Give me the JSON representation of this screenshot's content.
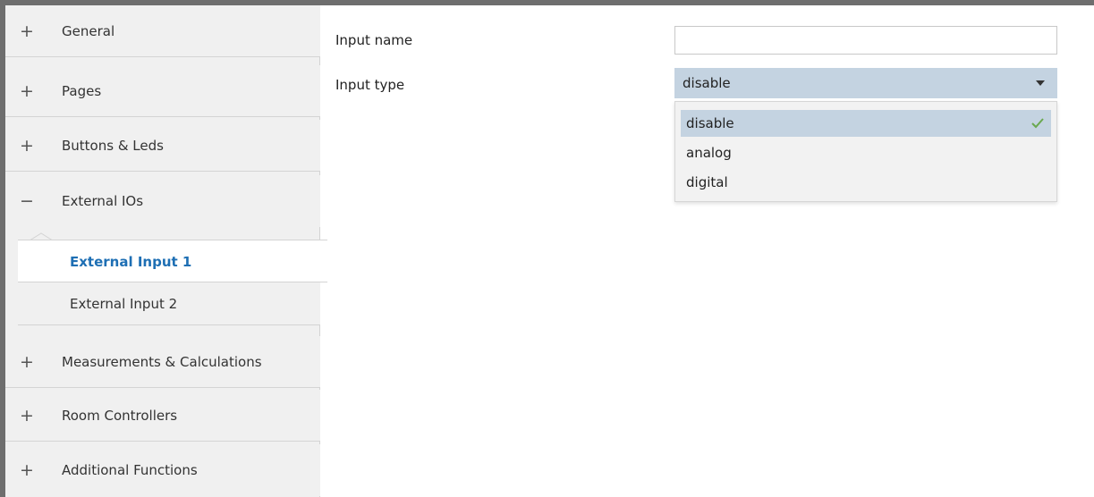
{
  "sidebar": {
    "items": [
      {
        "symbol": "+",
        "label": "General"
      },
      {
        "symbol": "+",
        "label": "Pages"
      },
      {
        "symbol": "+",
        "label": "Buttons & Leds"
      },
      {
        "symbol": "−",
        "label": "External IOs"
      },
      {
        "symbol": "+",
        "label": "Measurements & Calculations"
      },
      {
        "symbol": "+",
        "label": "Room Controllers"
      },
      {
        "symbol": "+",
        "label": "Additional Functions"
      }
    ],
    "subitems": [
      {
        "label": "External Input 1"
      },
      {
        "label": "External Input 2"
      }
    ]
  },
  "form": {
    "input_name_label": "Input name",
    "input_name_value": "",
    "input_type_label": "Input type",
    "input_type_value": "disable",
    "options": [
      "disable",
      "analog",
      "digital"
    ]
  },
  "colors": {
    "accent": "#1e6fb4",
    "selection": "#c4d3e1",
    "check": "#6aa84f"
  },
  "icons": {
    "expand": "plus-icon",
    "collapse": "minus-icon",
    "dropdown": "chevron-down-icon",
    "selected": "check-icon"
  }
}
